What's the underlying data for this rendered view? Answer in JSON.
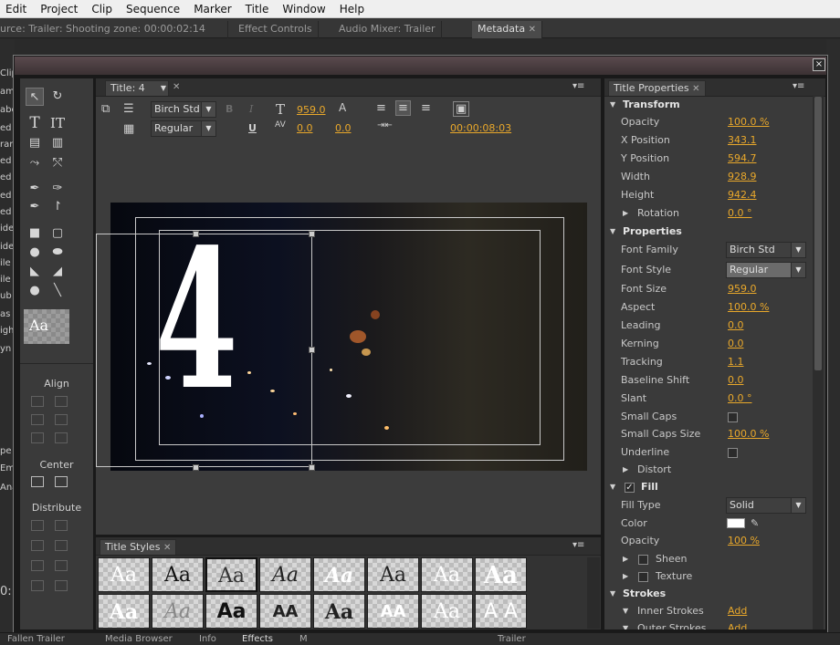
{
  "menu": [
    "Edit",
    "Project",
    "Clip",
    "Sequence",
    "Marker",
    "Title",
    "Window",
    "Help"
  ],
  "top_tabs": {
    "source": "urce: Trailer: Shooting zone: 00:00:02:14",
    "effect_controls": "Effect Controls",
    "audio_mixer": "Audio Mixer: Trailer",
    "metadata": "Metadata"
  },
  "left_edge_labels": [
    "Clip",
    "am",
    "abe",
    "ed",
    "ran",
    "ed",
    "ed",
    "ed",
    "ed",
    "ide",
    "ide",
    "ile",
    "ile",
    "ub",
    "as",
    "igh",
    "yn",
    "pe",
    "Em",
    "Ana",
    "0:"
  ],
  "dialog": {
    "close": "×"
  },
  "tools": {
    "align_label": "Align",
    "center_label": "Center",
    "distribute_label": "Distribute",
    "style_preview": "Aa"
  },
  "title_panel": {
    "tab": "Title: 4",
    "font_family": "Birch Std",
    "font_style": "Regular",
    "bold": "B",
    "italic": "I",
    "underline": "U",
    "font_size": "959.0",
    "kerning": "0.0",
    "leading": "0.0",
    "timecode": "00:00:08:03",
    "big_text": "4"
  },
  "styles_panel": {
    "tab": "Title Styles",
    "swatches": [
      "Aa",
      "Aa",
      "Aa",
      "Aa",
      "Aa",
      "Aa",
      "Aa",
      "Aa",
      "Aa",
      "Aa",
      "Aa",
      "AA",
      "Aa",
      "AA",
      "Aa",
      "A A"
    ]
  },
  "properties": {
    "tab": "Title Properties",
    "transform": "Transform",
    "opacity": {
      "label": "Opacity",
      "value": "100.0 %"
    },
    "x_position": {
      "label": "X Position",
      "value": "343.1"
    },
    "y_position": {
      "label": "Y Position",
      "value": "594.7"
    },
    "width": {
      "label": "Width",
      "value": "928.9"
    },
    "height": {
      "label": "Height",
      "value": "942.4"
    },
    "rotation": {
      "label": "Rotation",
      "value": "0.0 °"
    },
    "properties_head": "Properties",
    "font_family": {
      "label": "Font Family",
      "value": "Birch Std"
    },
    "font_style": {
      "label": "Font Style",
      "value": "Regular"
    },
    "font_size": {
      "label": "Font Size",
      "value": "959.0"
    },
    "aspect": {
      "label": "Aspect",
      "value": "100.0 %"
    },
    "leading": {
      "label": "Leading",
      "value": "0.0"
    },
    "kerning": {
      "label": "Kerning",
      "value": "0.0"
    },
    "tracking": {
      "label": "Tracking",
      "value": "1.1"
    },
    "baseline_shift": {
      "label": "Baseline Shift",
      "value": "0.0"
    },
    "slant": {
      "label": "Slant",
      "value": "0.0 °"
    },
    "small_caps": {
      "label": "Small Caps",
      "checked": false
    },
    "small_caps_size": {
      "label": "Small Caps Size",
      "value": "100.0 %"
    },
    "underline": {
      "label": "Underline",
      "checked": false
    },
    "distort": "Distort",
    "fill": {
      "label": "Fill",
      "checked": true
    },
    "fill_type": {
      "label": "Fill Type",
      "value": "Solid"
    },
    "color": {
      "label": "Color",
      "value": "#ffffff"
    },
    "fill_opacity": {
      "label": "Opacity",
      "value": "100 %"
    },
    "sheen": "Sheen",
    "texture": "Texture",
    "strokes": "Strokes",
    "inner_strokes": {
      "label": "Inner Strokes",
      "value": "Add"
    },
    "outer_strokes": {
      "label": "Outer Strokes",
      "value": "Add"
    }
  },
  "bottom_tabs": [
    "Fallen Trailer",
    "Media Browser",
    "Info",
    "Effects",
    "M",
    "Trailer"
  ],
  "colors": {
    "accent": "#e9a82b",
    "panel": "#3a3a3a",
    "dialog_bg": "#191919"
  }
}
